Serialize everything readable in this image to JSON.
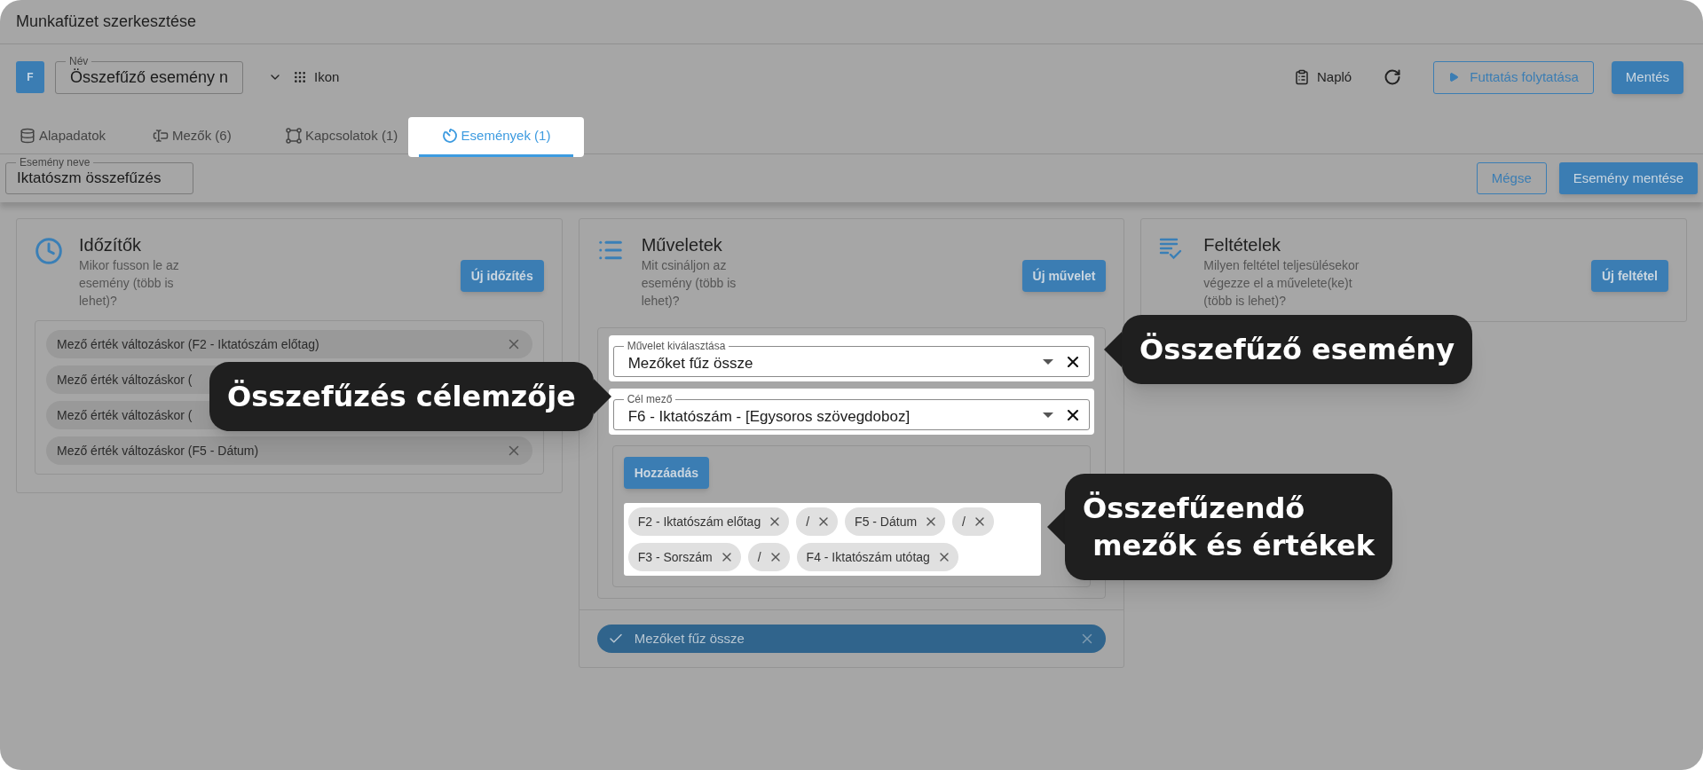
{
  "window": {
    "title": "Munkafüzet szerkesztése"
  },
  "toolbar": {
    "avatar": "F",
    "name_field": {
      "label": "Név",
      "value": "Összefűző esemény n"
    },
    "icon_picker": "Ikon",
    "log": "Napló",
    "buttons": [
      {
        "label": "Futtatás folytatása",
        "kind": "outline"
      },
      {
        "label": "Mentés",
        "kind": "primary"
      }
    ]
  },
  "tabs": [
    {
      "label": "Alapadatok",
      "selected": false,
      "highlighted": false
    },
    {
      "label": "Mezők (6)",
      "selected": false,
      "highlighted": false
    },
    {
      "label": "Kapcsolatok (1)",
      "selected": false,
      "highlighted": false
    },
    {
      "label": "Események (1)",
      "selected": true,
      "highlighted": true
    }
  ],
  "event_name": {
    "label": "Esemény neve",
    "value": "Iktatószm összefűzés"
  },
  "event_buttons": [
    {
      "label": "Mégse",
      "kind": "outline"
    },
    {
      "label": "Esemény mentése",
      "kind": "primary"
    }
  ],
  "panels": [
    {
      "kind": "timers",
      "title": "Időzítők",
      "description": "Mikor fusson le az esemény (több is lehet)?",
      "button": "Új időzítés",
      "chips": [
        "Mező érték változáskor (F2 - Iktatószám előtag)",
        "Mező érték változáskor (",
        "Mező érték változáskor (",
        "Mező érték változáskor (F5 - Dátum)"
      ]
    },
    {
      "kind": "actions",
      "title": "Műveletek",
      "description": "Mit csináljon az esemény (több is lehet)?",
      "button": "Új művelet",
      "selects": [
        {
          "label": "Művelet kiválasztása",
          "value": "Mezőket fűz össze",
          "highlighted": true
        },
        {
          "label": "Cél mező",
          "value": "F6 - Iktatószám - [Egysoros szövegdoboz]",
          "highlighted": true
        }
      ],
      "add_button": "Hozzáadás",
      "tags_highlighted": true,
      "tags": [
        "F2 - Iktatószám előtag",
        "/",
        "F5 - Dátum",
        "/",
        "F3 - Sorszám",
        "/",
        "F4 - Iktatószám utótag"
      ],
      "action_list": [
        {
          "label": "Mezőket fűz össze",
          "checked": true
        }
      ]
    },
    {
      "kind": "conditions",
      "title": "Feltételek",
      "description": "Milyen feltétel teljesülésekor végezze el a művelete(ke)t (több is lehet)?",
      "button": "Új feltétel"
    }
  ],
  "callouts": [
    {
      "text": "Összefűzés célemzője"
    },
    {
      "text": "Összefűző esemény"
    },
    {
      "text": "Összefűzendő\n mezők és értékek"
    }
  ]
}
